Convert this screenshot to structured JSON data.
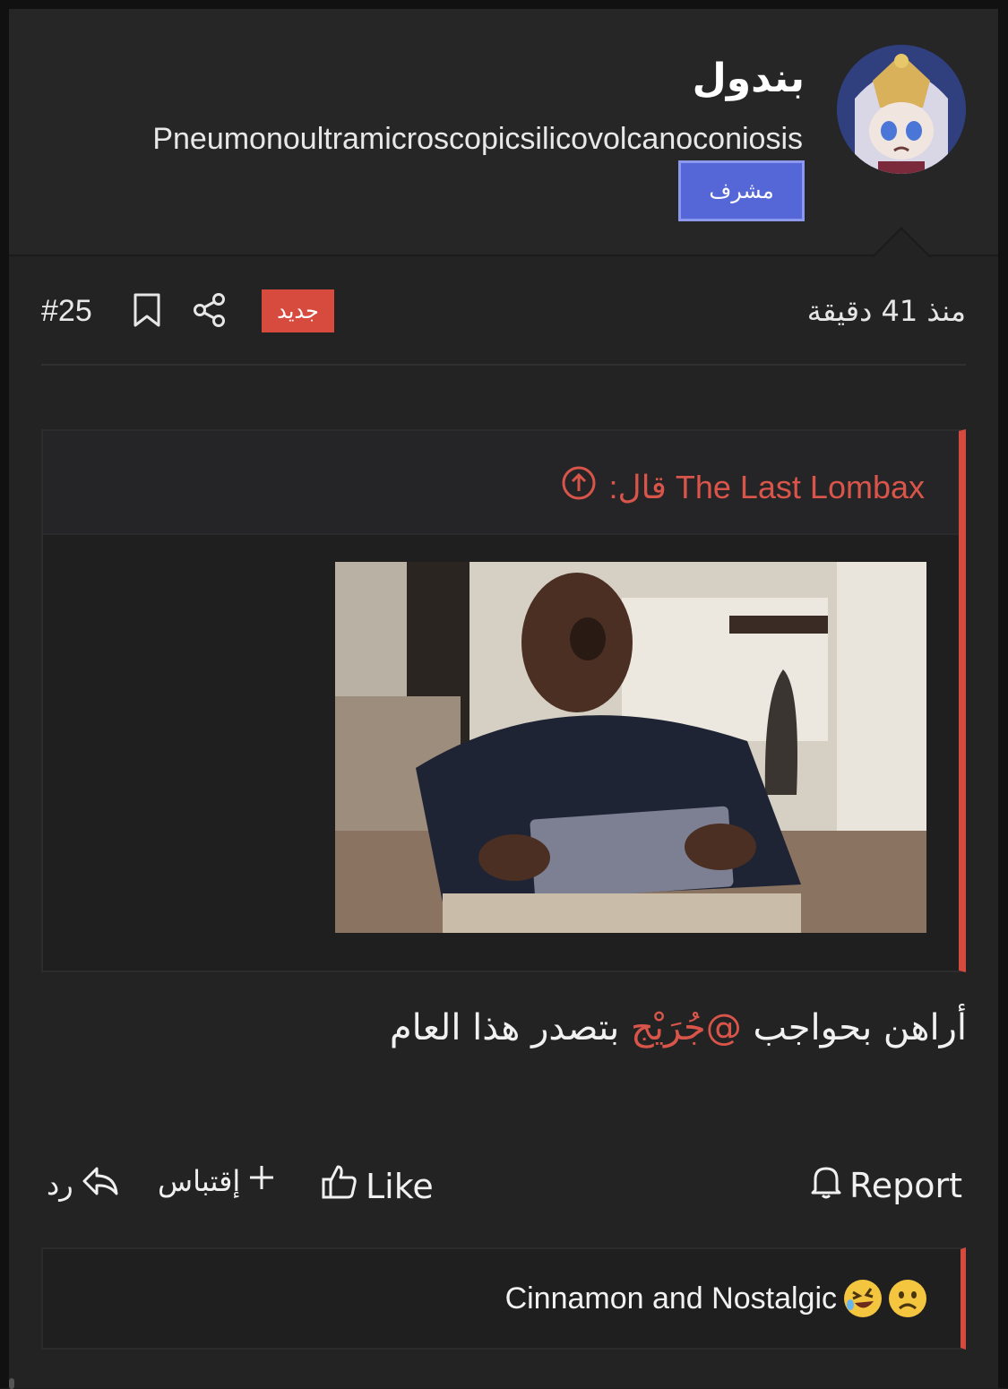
{
  "post": {
    "username": "بندول",
    "user_title": "Pneumonoultramicroscopicsilicovolcanoconiosis",
    "role_badge": "مشرف",
    "avatar_icon": "anime-avatar",
    "post_number": "#25",
    "new_badge": "جديد",
    "timestamp": "منذ 41 دقيقة",
    "quote": {
      "author_line": "The Last Lombax قال:",
      "image_alt": "laughing man holding tablet gif"
    },
    "body_before": "أراهن بحواجب ",
    "mention": "@جُرَيْج",
    "body_after": " بتصدر هذا العام",
    "actions": {
      "reply": "رد",
      "quote": "إقتباس",
      "like": "Like",
      "report": "Report"
    },
    "signature": "Cinnamon and Nostalgic"
  },
  "colors": {
    "accent_red": "#d74a3e",
    "badge_blue": "#5566d6",
    "background": "#232324"
  }
}
